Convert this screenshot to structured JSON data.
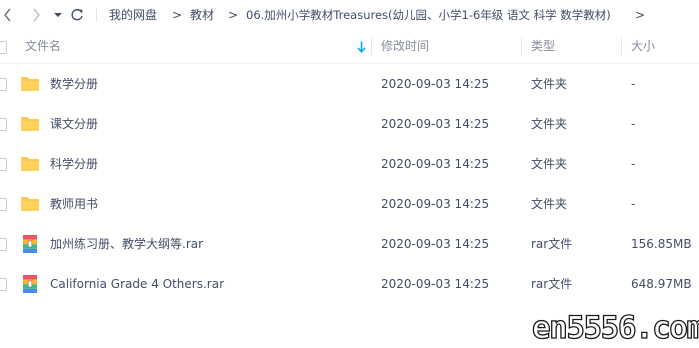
{
  "toolbar": {
    "back_icon": "chevron-left-icon",
    "forward_icon": "chevron-right-icon",
    "history_icon": "caret-down-icon",
    "refresh_icon": "refresh-icon",
    "breadcrumbs": [
      "我的网盘",
      "教材",
      "06.加州小学教材Treasures(幼儿园、小学1-6年级 语文 科学 数学教材)"
    ],
    "separator": ">"
  },
  "header": {
    "name": "文件名",
    "sort_icon": "sort-arrow-down-icon",
    "modified": "修改时间",
    "type": "类型",
    "size": "大小"
  },
  "files": [
    {
      "name": "数学分册",
      "modified": "2020-09-03 14:25",
      "type": "文件夹",
      "size": "-",
      "icon": "folder-icon"
    },
    {
      "name": "课文分册",
      "modified": "2020-09-03 14:25",
      "type": "文件夹",
      "size": "-",
      "icon": "folder-icon"
    },
    {
      "name": "科学分册",
      "modified": "2020-09-03 14:25",
      "type": "文件夹",
      "size": "-",
      "icon": "folder-icon"
    },
    {
      "name": "教师用书",
      "modified": "2020-09-03 14:25",
      "type": "文件夹",
      "size": "-",
      "icon": "folder-icon"
    },
    {
      "name": "加州练习册、教学大纲等.rar",
      "modified": "2020-09-03 14:25",
      "type": "rar文件",
      "size": "156.85MB",
      "icon": "rar-archive-icon"
    },
    {
      "name": "California Grade 4 Others.rar",
      "modified": "2020-09-03 14:25",
      "type": "rar文件",
      "size": "648.97MB",
      "icon": "rar-archive-icon"
    }
  ],
  "watermark": "en5556.com",
  "colors": {
    "text": "#424e67",
    "header_text": "#878c9c",
    "folder": "#ffc94d",
    "accent": "#06a7ff"
  }
}
